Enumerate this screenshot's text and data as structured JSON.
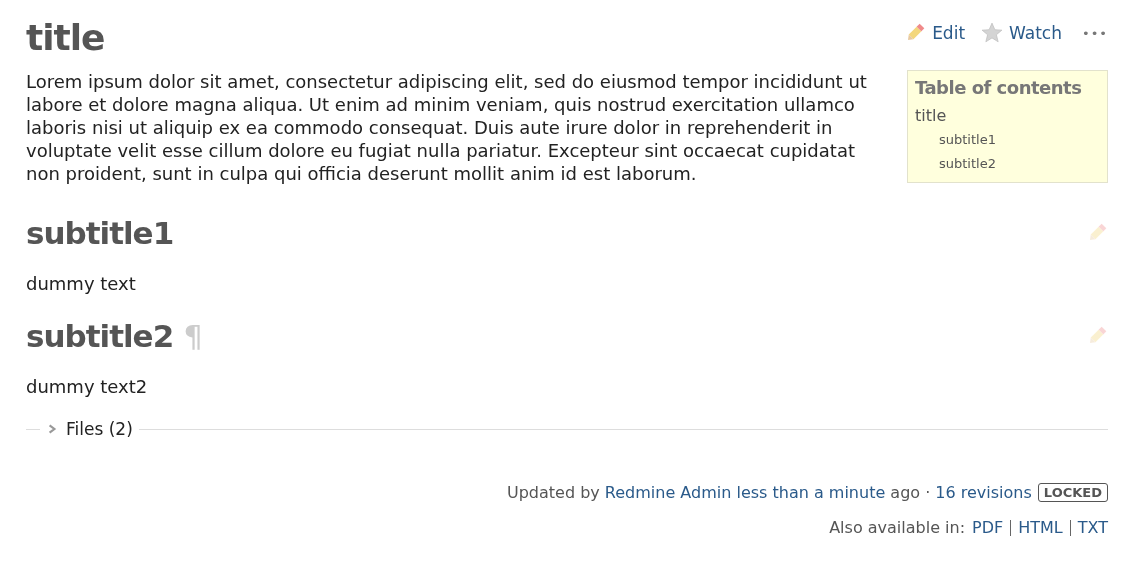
{
  "title": "title",
  "actions": [
    {
      "kind": "edit",
      "label": "Edit"
    },
    {
      "kind": "watch",
      "label": "Watch"
    },
    {
      "kind": "more",
      "label": "•••"
    }
  ],
  "intro": "Lorem ipsum dolor sit amet, consectetur adipiscing elit, sed do eiusmod tempor incididunt ut labore et dolore magna aliqua. Ut enim ad minim veniam, quis nostrud exercitation ullamco laboris nisi ut aliquip ex ea commodo consequat. Duis aute irure dolor in reprehenderit in voluptate velit esse cillum dolore eu fugiat nulla pariatur. Excepteur sint occaecat cupidatat non proident, sunt in culpa qui officia deserunt mollit anim id est laborum.",
  "toc": {
    "heading": "Table of contents",
    "items": [
      {
        "label": "title",
        "children": [
          {
            "label": "subtitle1"
          },
          {
            "label": "subtitle2"
          }
        ]
      }
    ]
  },
  "sections": [
    {
      "heading": "subtitle1",
      "body": "dummy text"
    },
    {
      "heading": "subtitle2",
      "anchor": "¶",
      "body": "dummy text2"
    }
  ],
  "files": {
    "label": "Files (2)",
    "expanded": false
  },
  "updated": {
    "prefix": "Updated by",
    "author": "Redmine Admin",
    "time": "less than a minute",
    "suffix": "ago ·",
    "revisions": "16 revisions",
    "badge": "LOCKED"
  },
  "exports": {
    "label": "Also available in:",
    "formats": [
      "PDF",
      "HTML",
      "TXT"
    ]
  }
}
